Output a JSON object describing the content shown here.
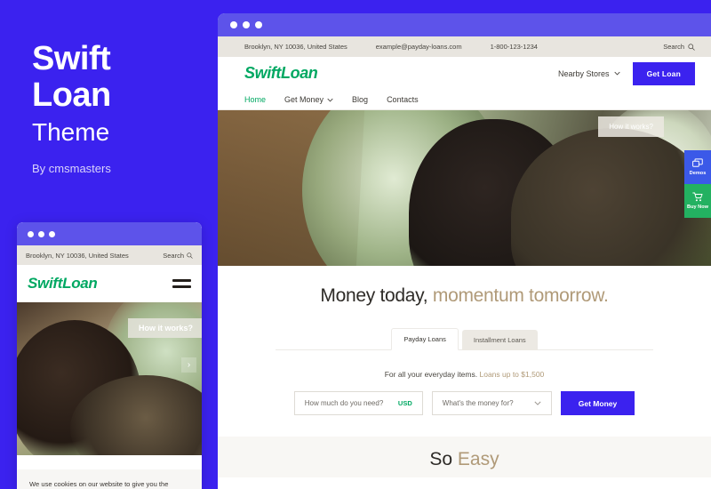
{
  "promo": {
    "title_line1": "Swift",
    "title_line2": "Loan",
    "subtitle": "Theme",
    "byline": "By cmsmasters",
    "bg_color": "#3b22ef"
  },
  "browser": {
    "titlebar_color": "#5d53ea",
    "topbar": {
      "address": "Brooklyn, NY 10036, United States",
      "email": "example@payday-loans.com",
      "phone": "1-800-123-1234",
      "search_label": "Search",
      "search_icon": "magnifier-icon"
    },
    "header": {
      "logo_part1": "Swift",
      "logo_part2": "Loan",
      "logo_color": "#00a862",
      "nearby_label": "Nearby Stores",
      "nearby_caret": "chevron-down-icon",
      "cta_label": "Get Loan",
      "cta_color": "#3b22ef"
    },
    "nav": [
      {
        "label": "Home",
        "active": true
      },
      {
        "label": "Get Money",
        "active": false,
        "caret": true
      },
      {
        "label": "Blog",
        "active": false
      },
      {
        "label": "Contacts",
        "active": false
      }
    ],
    "hero": {
      "how_it_works": "How it works?",
      "side_widgets": [
        {
          "label": "Demos",
          "icon": "windows-icon",
          "color": "#3b59e8"
        },
        {
          "label": "Buy Now",
          "icon": "cart-icon",
          "color": "#23b161"
        }
      ]
    },
    "content": {
      "headline_dark": "Money today,",
      "headline_gold": "momentum tomorrow.",
      "gold_color": "#b09a78",
      "tabs": [
        {
          "label": "Payday Loans",
          "active": true
        },
        {
          "label": "Installment Loans",
          "active": false
        }
      ],
      "note_dark": "For all your everyday items.",
      "note_gold": "Loans up to $1,500",
      "amount_placeholder": "How much do you need?",
      "currency": "USD",
      "purpose_placeholder": "What's the money for?",
      "submit_label": "Get Money",
      "section_dark": "So",
      "section_gold": "Easy"
    }
  },
  "mobile": {
    "titlebar_color": "#5d53ea",
    "topbar_address": "Brooklyn, NY 10036, United States",
    "search_label": "Search",
    "logo_part1": "Swift",
    "logo_part2": "Loan",
    "how_it_works": "How it works?",
    "slider_next": "›",
    "cookie_text": "We use cookies on our website to give you the"
  }
}
